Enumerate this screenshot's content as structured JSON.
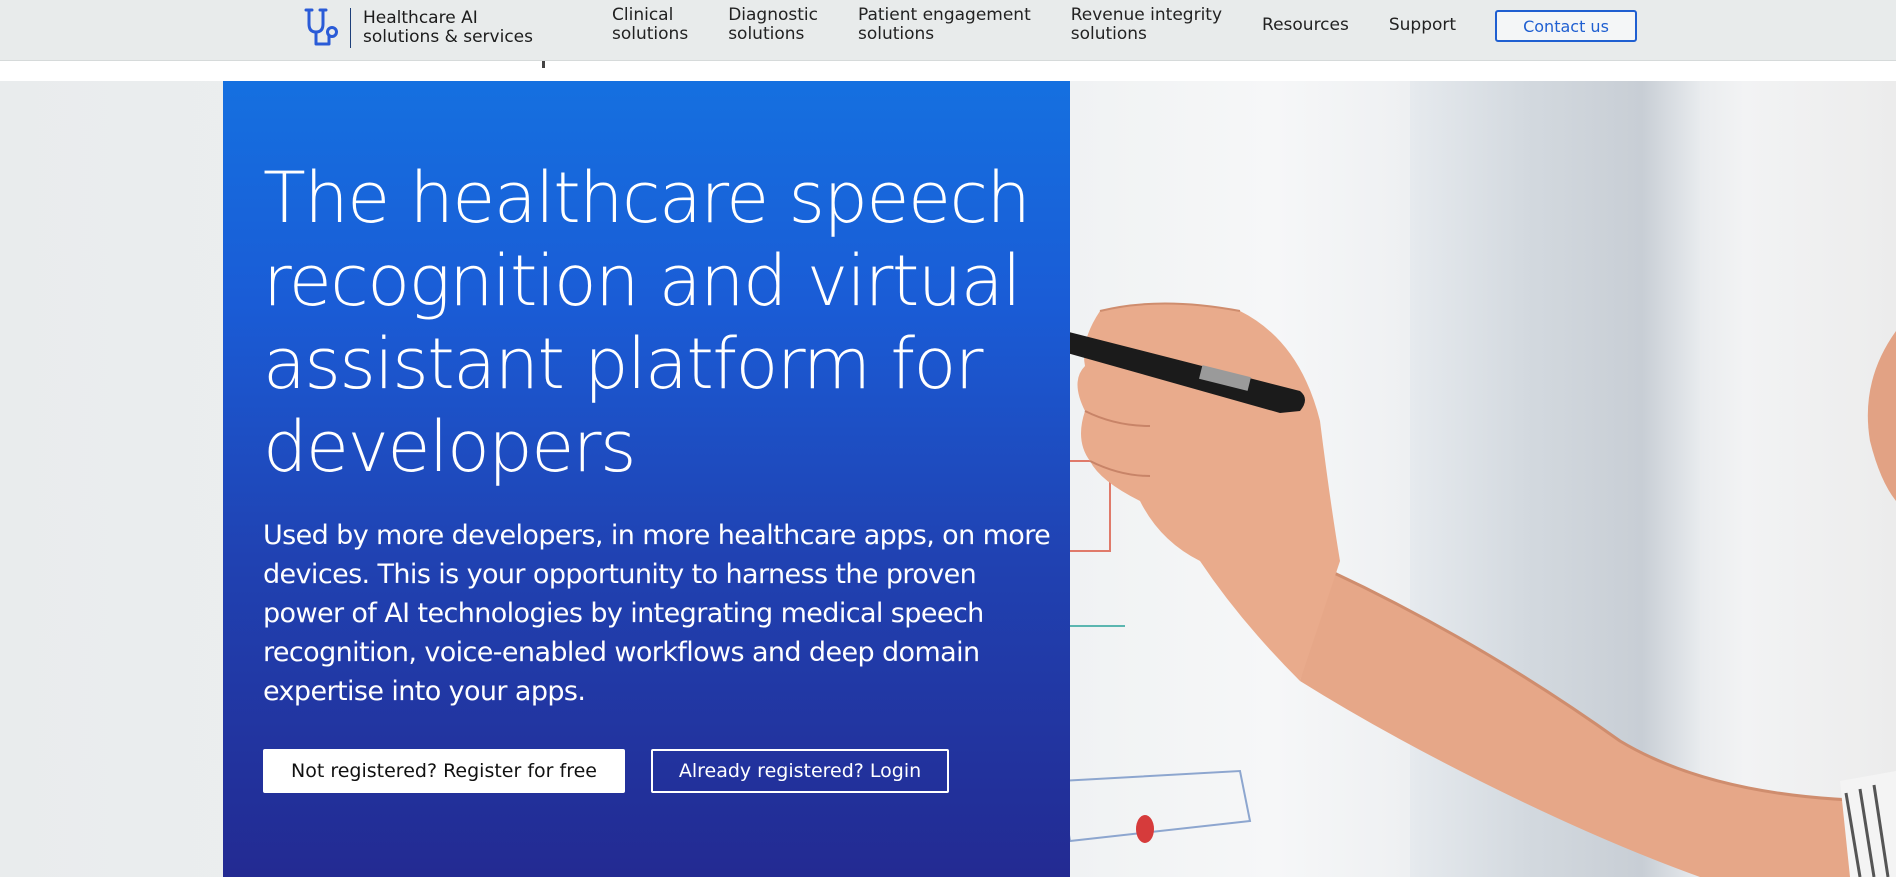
{
  "header": {
    "brand_text_line1": "Healthcare AI",
    "brand_text_line2": "solutions & services",
    "logo_icon": "stethoscope-icon",
    "nav": [
      {
        "line1": "Clinical",
        "line2": "solutions"
      },
      {
        "line1": "Diagnostic",
        "line2": "solutions"
      },
      {
        "line1": "Patient engagement",
        "line2": "solutions"
      },
      {
        "line1": "Revenue integrity",
        "line2": "solutions"
      },
      {
        "line1": "Resources",
        "line2": ""
      },
      {
        "line1": "Support",
        "line2": ""
      }
    ],
    "contact_label": "Contact us"
  },
  "hero": {
    "title": "The healthcare speech recognition and virtual assistant platform for developers",
    "description": "Used by more developers, in more healthcare apps, on more devices. This is your opportunity to harness the proven power of AI technologies by integrating medical speech recognition, voice-enabled workflows and deep domain expertise into your apps.",
    "register_label": "Not registered? Register for free",
    "login_label": "Already registered? Login"
  },
  "colors": {
    "accent": "#1f5fd1",
    "panel_top": "#1570e0",
    "panel_bottom": "#232a92",
    "topbar_bg": "#e8ebeb"
  }
}
